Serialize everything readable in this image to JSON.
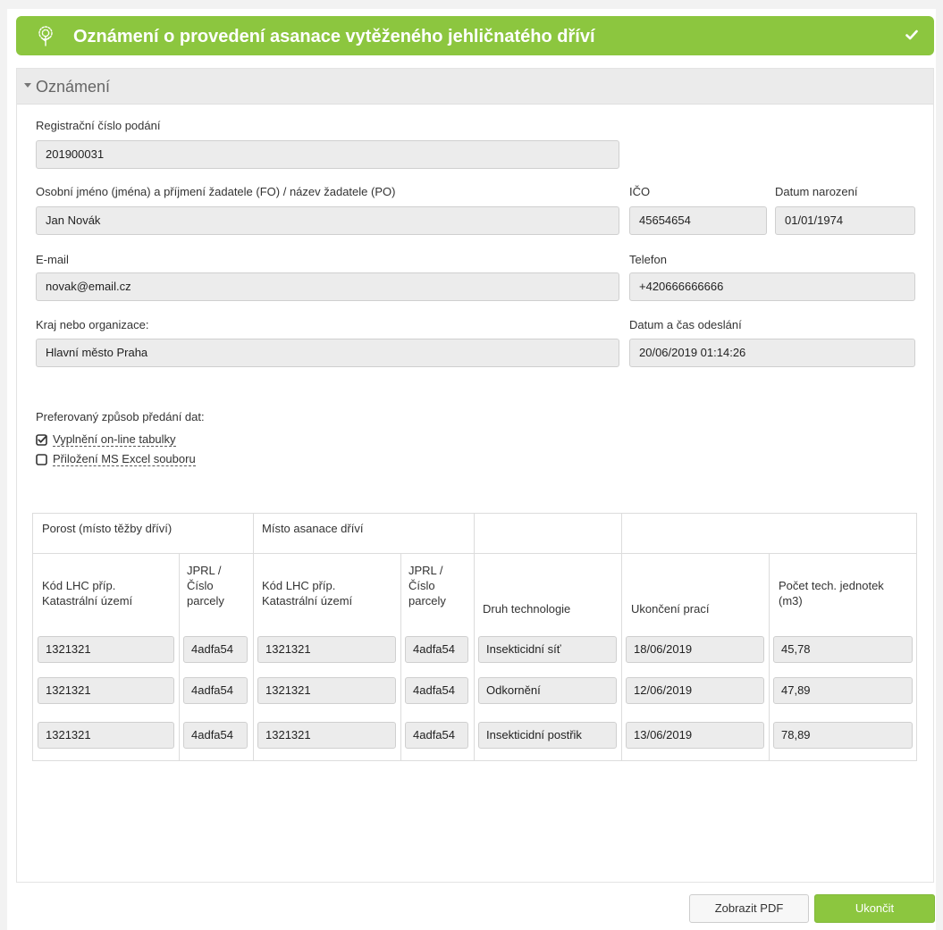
{
  "header": {
    "title": "Oznámení o provedení asanace vytěženého jehličnatého dříví",
    "accent": "#8cc63f"
  },
  "section": {
    "title": "Oznámení"
  },
  "form": {
    "reg_label": "Registrační číslo podání",
    "reg_value": "201900031",
    "name_label": "Osobní jméno (jména) a příjmení žadatele (FO) / název žadatele (PO)",
    "name_value": "Jan Novák",
    "ico_label": "IČO",
    "ico_value": "45654654",
    "dob_label": "Datum narození",
    "dob_value": "01/01/1974",
    "email_label": "E-mail",
    "email_value": "novak@email.cz",
    "phone_label": "Telefon",
    "phone_value": "+420666666666",
    "region_label": "Kraj nebo organizace:",
    "region_value": "Hlavní město Praha",
    "sent_label": "Datum a čas odeslání",
    "sent_value": "20/06/2019 01:14:26"
  },
  "transfer": {
    "label": "Preferovaný způsob předání dat:",
    "options": [
      {
        "label": "Vyplnění on-line tabulky",
        "checked": true
      },
      {
        "label": "Přiložení MS Excel souboru",
        "checked": false
      }
    ]
  },
  "table": {
    "group_headers": [
      "Porost (místo těžby dříví)",
      "Místo asanace dříví"
    ],
    "headers": [
      "Kód LHC příp. Katastrální území",
      "JPRL / Číslo parcely",
      "Kód LHC příp. Katastrální území",
      "JPRL / Číslo parcely",
      "Druh technologie",
      "Ukončení prací",
      "Počet tech. jednotek (m3)"
    ],
    "rows": [
      [
        "1321321",
        "4adfa54",
        "1321321",
        "4adfa54",
        "Insekticidní síť",
        "18/06/2019",
        "45,78"
      ],
      [
        "1321321",
        "4adfa54",
        "1321321",
        "4adfa54",
        "Odkornění",
        "12/06/2019",
        "47,89"
      ],
      [
        "1321321",
        "4adfa54",
        "1321321",
        "4adfa54",
        "Insekticidní postřik",
        "13/06/2019",
        "78,89"
      ]
    ]
  },
  "buttons": {
    "pdf": "Zobrazit PDF",
    "end": "Ukončit"
  }
}
